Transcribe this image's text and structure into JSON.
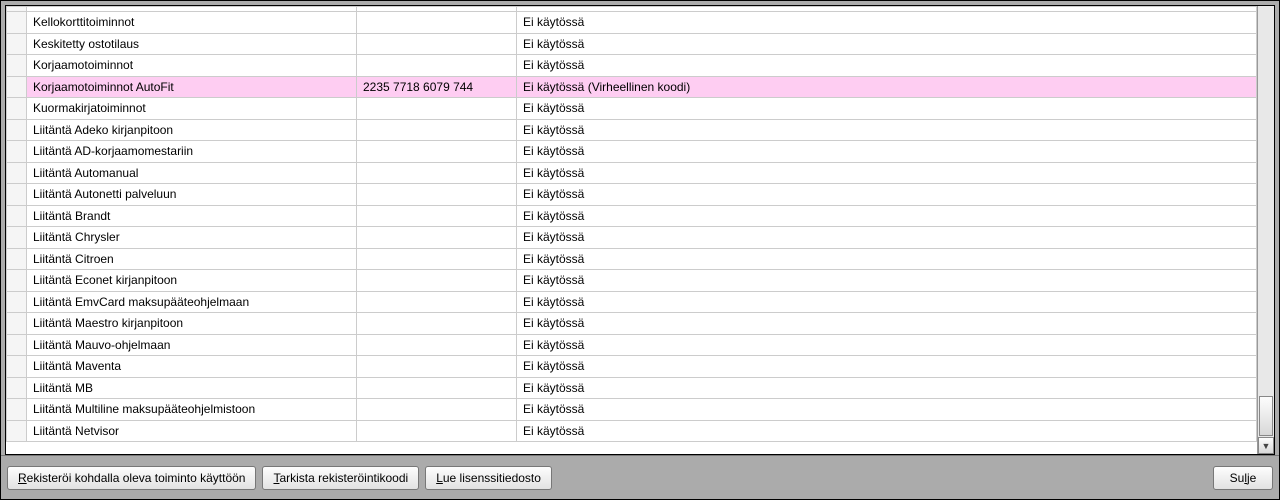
{
  "rows": [
    {
      "name": "",
      "code": "",
      "status": "",
      "partial": true
    },
    {
      "name": "Kellokorttitoiminnot",
      "code": "",
      "status": "Ei käytössä"
    },
    {
      "name": "Keskitetty ostotilaus",
      "code": "",
      "status": "Ei käytössä"
    },
    {
      "name": "Korjaamotoiminnot",
      "code": "",
      "status": "Ei käytössä"
    },
    {
      "name": "Korjaamotoiminnot AutoFit",
      "code": "2235 7718 6079 744",
      "status": "Ei käytössä (Virheellinen koodi)",
      "highlight": true
    },
    {
      "name": "Kuormakirjatoiminnot",
      "code": "",
      "status": "Ei käytössä"
    },
    {
      "name": "Liitäntä Adeko kirjanpitoon",
      "code": "",
      "status": "Ei käytössä"
    },
    {
      "name": "Liitäntä AD-korjaamomestariin",
      "code": "",
      "status": "Ei käytössä"
    },
    {
      "name": "Liitäntä Automanual",
      "code": "",
      "status": "Ei käytössä"
    },
    {
      "name": "Liitäntä Autonetti palveluun",
      "code": "",
      "status": "Ei käytössä"
    },
    {
      "name": "Liitäntä Brandt",
      "code": "",
      "status": "Ei käytössä"
    },
    {
      "name": "Liitäntä Chrysler",
      "code": "",
      "status": "Ei käytössä"
    },
    {
      "name": "Liitäntä Citroen",
      "code": "",
      "status": "Ei käytössä"
    },
    {
      "name": "Liitäntä Econet kirjanpitoon",
      "code": "",
      "status": "Ei käytössä"
    },
    {
      "name": "Liitäntä EmvCard maksupääteohjelmaan",
      "code": "",
      "status": "Ei käytössä"
    },
    {
      "name": "Liitäntä Maestro kirjanpitoon",
      "code": "",
      "status": "Ei käytössä"
    },
    {
      "name": "Liitäntä Mauvo-ohjelmaan",
      "code": "",
      "status": "Ei käytössä"
    },
    {
      "name": "Liitäntä Maventa",
      "code": "",
      "status": "Ei käytössä"
    },
    {
      "name": "Liitäntä MB",
      "code": "",
      "status": "Ei käytössä"
    },
    {
      "name": "Liitäntä Multiline maksupääteohjelmistoon",
      "code": "",
      "status": "Ei käytössä"
    },
    {
      "name": "Liitäntä Netvisor",
      "code": "",
      "status": "Ei käytössä"
    }
  ],
  "buttons": {
    "register": {
      "ul": "R",
      "rest": "ekisteröi kohdalla oleva toiminto käyttöön"
    },
    "check": {
      "ul": "T",
      "rest": "arkista rekisteröintikoodi"
    },
    "read": {
      "ul": "L",
      "rest": "ue lisenssitiedosto"
    },
    "close": {
      "pre": "Su",
      "ul": "l",
      "post": "je"
    }
  }
}
